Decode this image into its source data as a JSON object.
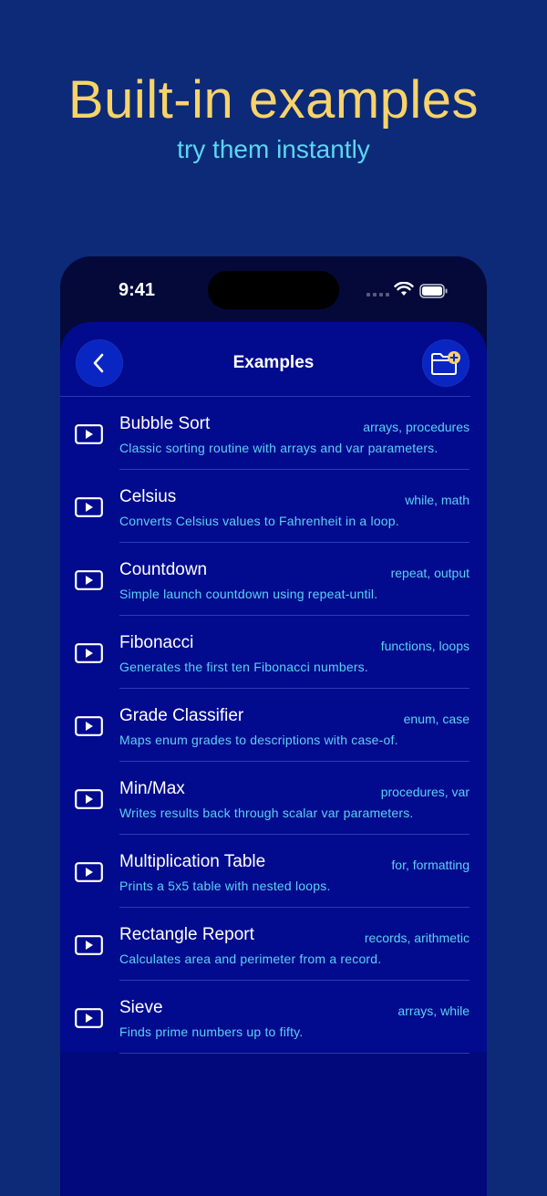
{
  "promo": {
    "title": "Built-in examples",
    "subtitle": "try them instantly"
  },
  "status_bar": {
    "time": "9:41",
    "icons": [
      "cellular-icon",
      "wifi-icon",
      "battery-icon"
    ]
  },
  "nav": {
    "title": "Examples",
    "back_icon": "chevron-left-icon",
    "action_icon": "folder-add-icon"
  },
  "examples": [
    {
      "title": "Bubble Sort",
      "tags": "arrays, procedures",
      "description": "Classic sorting routine with arrays and var parameters."
    },
    {
      "title": "Celsius",
      "tags": "while, math",
      "description": "Converts Celsius values to Fahrenheit in a loop."
    },
    {
      "title": "Countdown",
      "tags": "repeat, output",
      "description": "Simple launch countdown using repeat-until."
    },
    {
      "title": "Fibonacci",
      "tags": "functions, loops",
      "description": "Generates the first ten Fibonacci numbers."
    },
    {
      "title": "Grade Classifier",
      "tags": "enum, case",
      "description": "Maps enum grades to descriptions with case-of."
    },
    {
      "title": "Min/Max",
      "tags": "procedures, var",
      "description": "Writes results back through scalar var parameters."
    },
    {
      "title": "Multiplication Table",
      "tags": "for, formatting",
      "description": "Prints a 5x5 table with nested loops."
    },
    {
      "title": "Rectangle Report",
      "tags": "records, arithmetic",
      "description": "Calculates area and perimeter from a record."
    },
    {
      "title": "Sieve",
      "tags": "arrays, while",
      "description": "Finds prime numbers up to fifty."
    }
  ],
  "colors": {
    "background": "#0c2a78",
    "title": "#f7d36a",
    "accent": "#5cd6f2",
    "screen": "#020b8e"
  }
}
